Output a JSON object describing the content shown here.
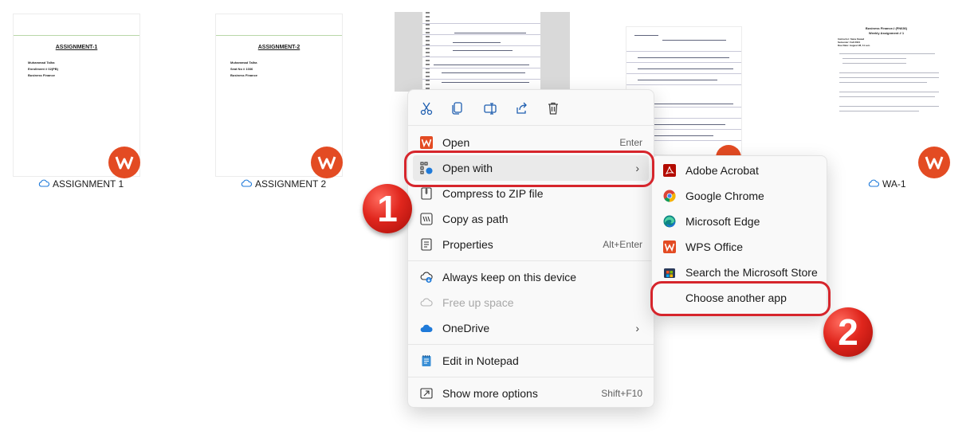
{
  "files": [
    {
      "name": "ASSIGNMENT 1",
      "heading": "ASSIGNMENT-1",
      "lines": [
        "Muhammad Talha",
        "Enrollment # 02(PB)",
        "Business Finance"
      ]
    },
    {
      "name": "ASSIGNMENT 2",
      "heading": "ASSIGNMENT-2",
      "lines": [
        "Muhammad Talha",
        "Seat No # 1036",
        "Business Finance"
      ]
    },
    {
      "name": "WA-1",
      "heading": "Business Finance-I (FN636)",
      "lines": [
        "Weekly Assignment # 1",
        "Instructor: Sana Fawad",
        "Semester: Fall 2024",
        "Due Date: August 28, 11 a.m."
      ]
    }
  ],
  "context_menu": {
    "toolbar": [
      {
        "name": "cut-icon"
      },
      {
        "name": "copy-icon"
      },
      {
        "name": "rename-icon"
      },
      {
        "name": "share-icon"
      },
      {
        "name": "delete-icon"
      }
    ],
    "items": [
      {
        "label": "Open",
        "shortcut": "Enter",
        "icon": "wps-icon"
      },
      {
        "label": "Open with",
        "shortcut": "",
        "icon": "open-with-icon",
        "submenu": true
      },
      {
        "label": "Compress to ZIP file",
        "shortcut": "",
        "icon": "zip-icon"
      },
      {
        "label": "Copy as path",
        "shortcut": "",
        "icon": "copy-path-icon"
      },
      {
        "label": "Properties",
        "shortcut": "Alt+Enter",
        "icon": "properties-icon"
      },
      {
        "label": "Always keep on this device",
        "shortcut": "",
        "icon": "cloud-download-icon"
      },
      {
        "label": "Free up space",
        "shortcut": "",
        "icon": "cloud-icon",
        "disabled": true
      },
      {
        "label": "OneDrive",
        "shortcut": "",
        "icon": "onedrive-icon",
        "submenu": true
      },
      {
        "label": "Edit in Notepad",
        "shortcut": "",
        "icon": "notepad-icon"
      },
      {
        "label": "Show more options",
        "shortcut": "Shift+F10",
        "icon": "more-options-icon"
      }
    ]
  },
  "submenu": {
    "items": [
      {
        "label": "Adobe Acrobat",
        "icon": "adobe-acrobat-icon"
      },
      {
        "label": "Google Chrome",
        "icon": "chrome-icon"
      },
      {
        "label": "Microsoft Edge",
        "icon": "edge-icon"
      },
      {
        "label": "WPS Office",
        "icon": "wps-office-icon"
      },
      {
        "label": "Search the Microsoft Store",
        "icon": "store-icon"
      },
      {
        "label": "Choose another app",
        "icon": ""
      }
    ]
  },
  "annotations": {
    "step1": "1",
    "step2": "2"
  },
  "colors": {
    "highlight": "#d6252c",
    "wps": "#e34b23",
    "onedrive": "#1f7ad9"
  }
}
